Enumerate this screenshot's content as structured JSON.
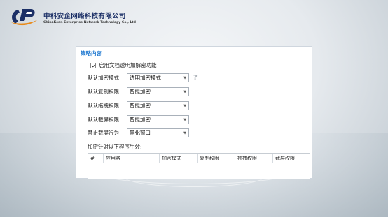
{
  "brand": {
    "name_cn": "中科安企网络科技有限公司",
    "name_en": "ChinaKean Enterprise Network Technology Co., Ltd"
  },
  "panel": {
    "title": "策略内容",
    "enable_checkbox_label": "启用文档透明加解密功能",
    "enable_checked": true,
    "fields": [
      {
        "label": "默认加密模式",
        "value": "透明加密模式"
      },
      {
        "label": "默认复制权限",
        "value": "智能加密"
      },
      {
        "label": "默认拖拽权限",
        "value": "智能加密"
      },
      {
        "label": "默认截屏权限",
        "value": "智能加密"
      },
      {
        "label": "禁止截屏行为",
        "value": "黑化窗口"
      }
    ],
    "help_icon": "question-mark",
    "list_label": "加密针对以下程序生效:",
    "table_headers": [
      "#",
      "应用名",
      "加密模式",
      "复制权限",
      "拖拽权限",
      "截屏权限"
    ]
  },
  "colors": {
    "brand_blue": "#1b2f66",
    "accent": "#1e78d0"
  }
}
